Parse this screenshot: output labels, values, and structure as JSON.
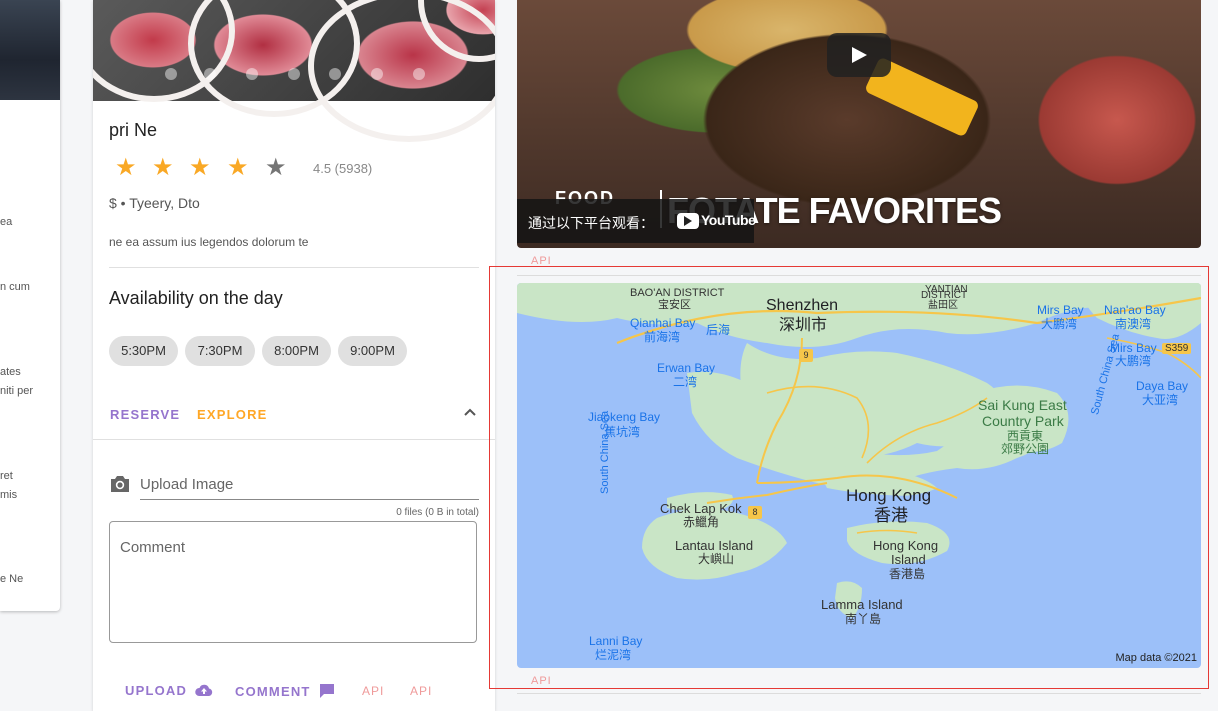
{
  "left_card": {
    "snippets": [
      "ea",
      "n cum",
      "ates",
      "niti per",
      "ret",
      "mis",
      "e Ne"
    ]
  },
  "restaurant": {
    "name": "pri Ne",
    "rating_value": 4.5,
    "rating_text": "4.5 (5938)",
    "stars_filled": 4,
    "stars_total": 5,
    "meta": "$ • Tyeery, Dto",
    "description": "ne ea assum ius legendos dolorum te",
    "availability_title": "Availability on the day",
    "times": [
      "5:30PM",
      "7:30PM",
      "8:00PM",
      "9:00PM"
    ],
    "reserve_label": "RESERVE",
    "explore_label": "EXPLORE",
    "upload_image_label": "Upload Image",
    "files_info": "0 files (0 B in total)",
    "comment_placeholder": "Comment",
    "upload_label": "UPLOAD",
    "comment_label": "COMMENT",
    "api_label_1": "API",
    "api_label_2": "API"
  },
  "video": {
    "title_text": "TATE FAVORITES",
    "title_prefix": "FO",
    "brand_text": "FOOD",
    "watch_on": "通过以下平台观看：",
    "youtube": "YouTube"
  },
  "api_top": "API",
  "api_bottom": "API",
  "map": {
    "attribution": "Map data ©2021",
    "labels": {
      "baoan": "BAO'AN DISTRICT",
      "baoan_cn": "宝安区",
      "yantian": "YANTIAN",
      "yantian2": "DISTRICT",
      "yantian_cn": "盐田区",
      "shenzhen": "Shenzhen",
      "shenzhen_cn": "深圳市",
      "qianhai": "Qianhai Bay",
      "qianhai_cn": "前海湾",
      "houhai_cn": "后海",
      "mirs": "Mirs Bay",
      "mirs_cn": "大鹏湾",
      "nanao": "Nan'ao Bay",
      "nanao_cn": "南澳湾",
      "mirs2": "Mirs Bay",
      "mirs2_cn": "大鹏湾",
      "erwan": "Erwan Bay",
      "erwan_cn": "二湾",
      "dayabay": "Daya Bay",
      "dayabay_cn": "大亚湾",
      "jiaokeng": "Jiaokeng Bay",
      "jiaokeng_cn": "蕉坑湾",
      "saikung": "Sai Kung East",
      "country": "Country Park",
      "saikung_cn": "西貢東",
      "park_cn": "郊野公園",
      "south_china_sea": "South China Sea",
      "south_china_sea_2": "South China Sea",
      "hongkong": "Hong Kong",
      "hongkong_cn": "香港",
      "cheklapkok": "Chek Lap Kok",
      "cheklapkok_cn": "赤鱲角",
      "lantau": "Lantau Island",
      "lantau_cn": "大嶼山",
      "hkisland": "Hong Kong",
      "hkisland2": "Island",
      "hkisland_cn": "香港島",
      "lamma": "Lamma Island",
      "lamma_cn": "南丫島",
      "lanni": "Lanni Bay",
      "lanni_cn": "烂泥湾",
      "road_9": "9",
      "road_8": "8",
      "road_s359": "S359"
    }
  },
  "colors": {
    "star": "#f9a825",
    "star_empty": "#757575",
    "reserve": "#9575cd",
    "explore": "#ffa726",
    "api": "#ef9a9a",
    "highlight_box": "#e53935",
    "water": "#9cc0f9",
    "land": "#c9e5c6"
  }
}
